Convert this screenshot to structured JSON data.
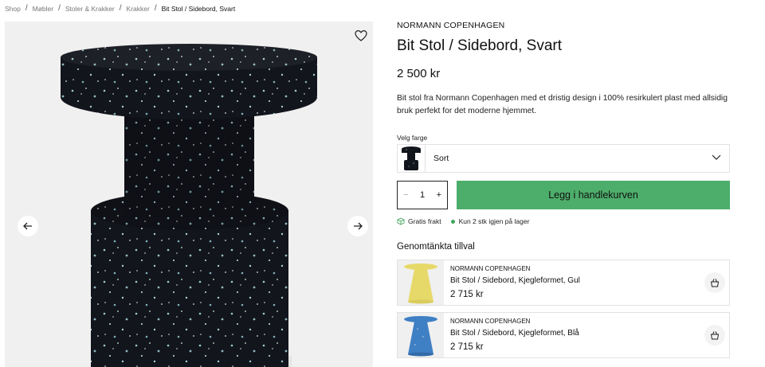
{
  "breadcrumb": [
    "Shop",
    "Møbler",
    "Stoler & Krakker",
    "Krakker",
    "Bit Stol / Sidebord, Svart"
  ],
  "product": {
    "brand": "NORMANN COPENHAGEN",
    "title": "Bit Stol / Sidebord, Svart",
    "price": "2 500 kr",
    "description": "Bit stol fra Normann Copenhagen med et dristig design i 100% resirkulert plast med allsidig bruk perfekt for det moderne hjemmet."
  },
  "color": {
    "label": "Velg farge",
    "selected": "Sort"
  },
  "quantity": {
    "value": "1",
    "minus": "−",
    "plus": "+"
  },
  "add_to_cart": "Legg i handlekurven",
  "perks": {
    "shipping": "Gratis frakt",
    "stock": "Kun 2 stk igjen på lager"
  },
  "accessories": {
    "title": "Genomtänkta tillval",
    "items": [
      {
        "brand": "NORMANN COPENHAGEN",
        "name": "Bit Stol / Sidebord, Kjegleformet, Gul",
        "price": "2 715 kr",
        "color": "#e6d96a"
      },
      {
        "brand": "NORMANN COPENHAGEN",
        "name": "Bit Stol / Sidebord, Kjegleformet, Blå",
        "price": "2 715 kr",
        "color": "#3f7fc4"
      }
    ]
  },
  "colors": {
    "accent": "#4dae6b",
    "stock_dot": "#3fa55a",
    "product_black": "#12151c"
  }
}
